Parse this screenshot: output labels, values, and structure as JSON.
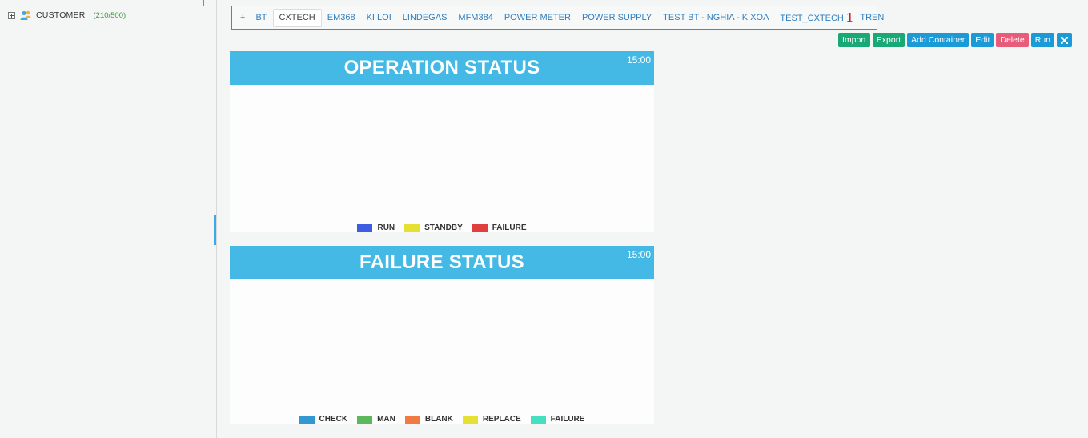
{
  "sidebar": {
    "root_label": "CUSTOMER",
    "root_count": "(210/500)",
    "root_icon": "customer-user-icon"
  },
  "tabs": [
    {
      "label": "+",
      "active": false
    },
    {
      "label": "BT",
      "active": false
    },
    {
      "label": "CXTECH",
      "active": true
    },
    {
      "label": "EM368",
      "active": false
    },
    {
      "label": "KI LOI",
      "active": false
    },
    {
      "label": "LINDEGAS",
      "active": false
    },
    {
      "label": "MFM384",
      "active": false
    },
    {
      "label": "POWER METER",
      "active": false
    },
    {
      "label": "POWER SUPPLY",
      "active": false
    },
    {
      "label": "TEST BT - NGHIA - K XOA",
      "active": false
    },
    {
      "label": "TEST_CXTECH",
      "active": false
    },
    {
      "label": "TREN",
      "active": false
    }
  ],
  "tab_marker": "1",
  "toolbar": {
    "import": "Import",
    "export": "Export",
    "add_container": "Add Container",
    "edit": "Edit",
    "delete": "Delete",
    "run": "Run",
    "fullscreen_icon": "expand-arrows-icon"
  },
  "panels": {
    "operation": {
      "title": "OPERATION STATUS",
      "time": "15:00",
      "legend": [
        {
          "label": "RUN",
          "color": "#3d5ee3"
        },
        {
          "label": "STANDBY",
          "color": "#e6e033"
        },
        {
          "label": "FAILURE",
          "color": "#e03f3f"
        }
      ]
    },
    "failure": {
      "title": "FAILURE STATUS",
      "time": "15:00",
      "legend": [
        {
          "label": "CHECK",
          "color": "#3398d0"
        },
        {
          "label": "MAN",
          "color": "#5cb85c"
        },
        {
          "label": "BLANK",
          "color": "#f07a42"
        },
        {
          "label": "REPLACE",
          "color": "#e6e033"
        },
        {
          "label": "FAILURE",
          "color": "#46dfc0"
        }
      ]
    }
  },
  "colors": {
    "header": "#44b9e6",
    "tab_text": "#2e7fc0",
    "tabs_outline": "#d9534f",
    "btn_green": "#19a974",
    "btn_blue": "#1b9ad8",
    "btn_red": "#e85c79"
  }
}
